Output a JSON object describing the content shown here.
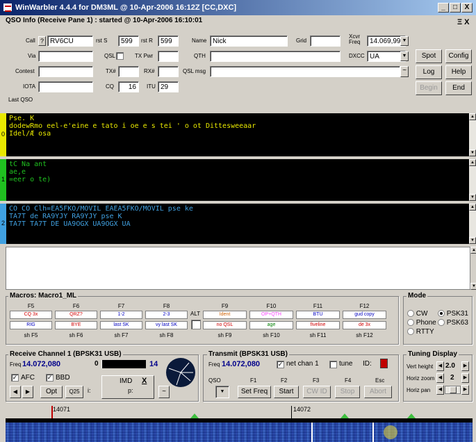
{
  "window": {
    "title": "WinWarbler 4.4.4 for DM3ML @ 10-Apr-2006 16:12Z [CC,DXC]",
    "min": "_",
    "max": "□",
    "close": "X"
  },
  "qso": {
    "title": "QSO Info (Receive Pane 1) : started @ 10-Apr-2006 16:10:01",
    "call_label": "Call",
    "call_q": "?",
    "call": "RV6CU",
    "rsts_label": "rst S",
    "rsts": "599",
    "rstr_label": "rst R",
    "rstr": "599",
    "name_label": "Name",
    "name": "Nick",
    "grid_label": "Grid",
    "grid": "",
    "xcvr_label": "Xcvr Freq",
    "xcvr": "14.069,99",
    "via_label": "Via",
    "via": "",
    "qsl_label": "QSL",
    "txpwr_label": "TX Pwr",
    "txpwr": "",
    "qth_label": "QTH",
    "qth": "",
    "dxcc_label": "DXCC",
    "dxcc": "UA",
    "contest_label": "Contest",
    "contest": "",
    "txn_label": "TX#",
    "txn": "",
    "rxn_label": "RX#",
    "rxn": "",
    "qslmsg_label": "QSL msg",
    "qslmsg": "",
    "qslmsg_btn": "~",
    "iota_label": "IOTA",
    "iota": "",
    "cq_label": "CQ",
    "cq": "16",
    "itu_label": "ITU",
    "itu": "29",
    "lastqso_label": "Last QSO",
    "buttons": {
      "spot": "Spot",
      "config": "Config",
      "log": "Log",
      "help": "Help",
      "begin": "Begin",
      "end": "End"
    },
    "corner": "Ξ X"
  },
  "panes": [
    {
      "num": "0",
      "color": "#e8e800",
      "lines": [
        "Pse. K",
        "dodewRmo eel-e'eine e tato   i oe e s  tei '   o ot Dittesweeaar",
        "Idel/Æ osa"
      ]
    },
    {
      "num": "1",
      "color": "#20c020",
      "lines": [
        "tC Na ant",
        " ae,e",
        "=eer o te)"
      ]
    },
    {
      "num": "2",
      "color": "#40a0e0",
      "lines": [
        "CO CO Clh=EA5FKO/MOVIL EAEA5FKO/MOVIL pse ke",
        "TA7T de RA9YJY RA9YJY pse K",
        " TA7T TA7T  DE UA9OGX UA9OGX UA"
      ]
    }
  ],
  "macros": {
    "title": "Macros: Macro1_ML",
    "fkeys_left": [
      "F5",
      "F6",
      "F7",
      "F8"
    ],
    "fkeys_right": [
      "F9",
      "F10",
      "F11",
      "F12"
    ],
    "row1_left": [
      {
        "t": "CQ 3x",
        "c": "#d00000"
      },
      {
        "t": "QRZ?",
        "c": "#d00000"
      },
      {
        "t": "1-2",
        "c": "#0000c0"
      },
      {
        "t": "2-3",
        "c": "#0000c0"
      }
    ],
    "row2_left": [
      {
        "t": "RIG",
        "c": "#0000c0"
      },
      {
        "t": "BYE",
        "c": "#d00000"
      },
      {
        "t": "last SK",
        "c": "#0000c0"
      },
      {
        "t": "vy last SK",
        "c": "#0000c0"
      }
    ],
    "row1_right": [
      {
        "t": "Ident",
        "c": "#d06000"
      },
      {
        "t": "OP+QTH",
        "c": "#ff40ff"
      },
      {
        "t": "BTU",
        "c": "#0000c0"
      },
      {
        "t": "gud copy",
        "c": "#0000c0"
      }
    ],
    "row2_right": [
      {
        "t": "no QSL",
        "c": "#d00000"
      },
      {
        "t": "age",
        "c": "#008000"
      },
      {
        "t": "fiveline",
        "c": "#d00000"
      },
      {
        "t": "de 3x",
        "c": "#d00000"
      }
    ],
    "shkeys_left": [
      "sh F5",
      "sh F6",
      "sh F7",
      "sh F8"
    ],
    "shkeys_right": [
      "sh F9",
      "sh F10",
      "sh F11",
      "sh F12"
    ],
    "alt": "ALT"
  },
  "mode": {
    "title": "Mode",
    "options": [
      "CW",
      "PSK31",
      "Phone",
      "PSK63",
      "RTTY"
    ],
    "selected": "PSK31"
  },
  "receive": {
    "title": "Receive Channel 1 (BPSK31 USB)",
    "freq_label": "Freq",
    "freq": "14.072,080",
    "level_left": "0",
    "level_right": "14",
    "level": 0.02,
    "afc": "AFC",
    "bbd": "BBD",
    "opt": "Opt",
    "q25": "Q25",
    "imd": "IMD",
    "imd_x": "X",
    "i_label": "i:",
    "p_label": "p:",
    "tilde": "~"
  },
  "transmit": {
    "title": "Transmit (BPSK31 USB)",
    "freq_label": "Freq",
    "freq": "14.072,080",
    "netchan": "net chan 1",
    "tune": "tune",
    "id": "ID:",
    "qso": "QSO",
    "fkeys": [
      "F1",
      "F2",
      "F3",
      "F4",
      "Esc"
    ],
    "buttons": [
      "Set Freq",
      "Start",
      "CW ID",
      "Stop",
      "Abort"
    ]
  },
  "tuning": {
    "title": "Tuning Display",
    "vert_label": "Vert height",
    "vert": "2.0",
    "horiz_label": "Horiz zoom",
    "horiz": "2",
    "pan_label": "Horiz pan"
  },
  "waterfall": {
    "tick1": "14071",
    "tick2": "14072"
  },
  "colors": {
    "titlebar": "#0a246a",
    "pane_bg": "#000000"
  }
}
